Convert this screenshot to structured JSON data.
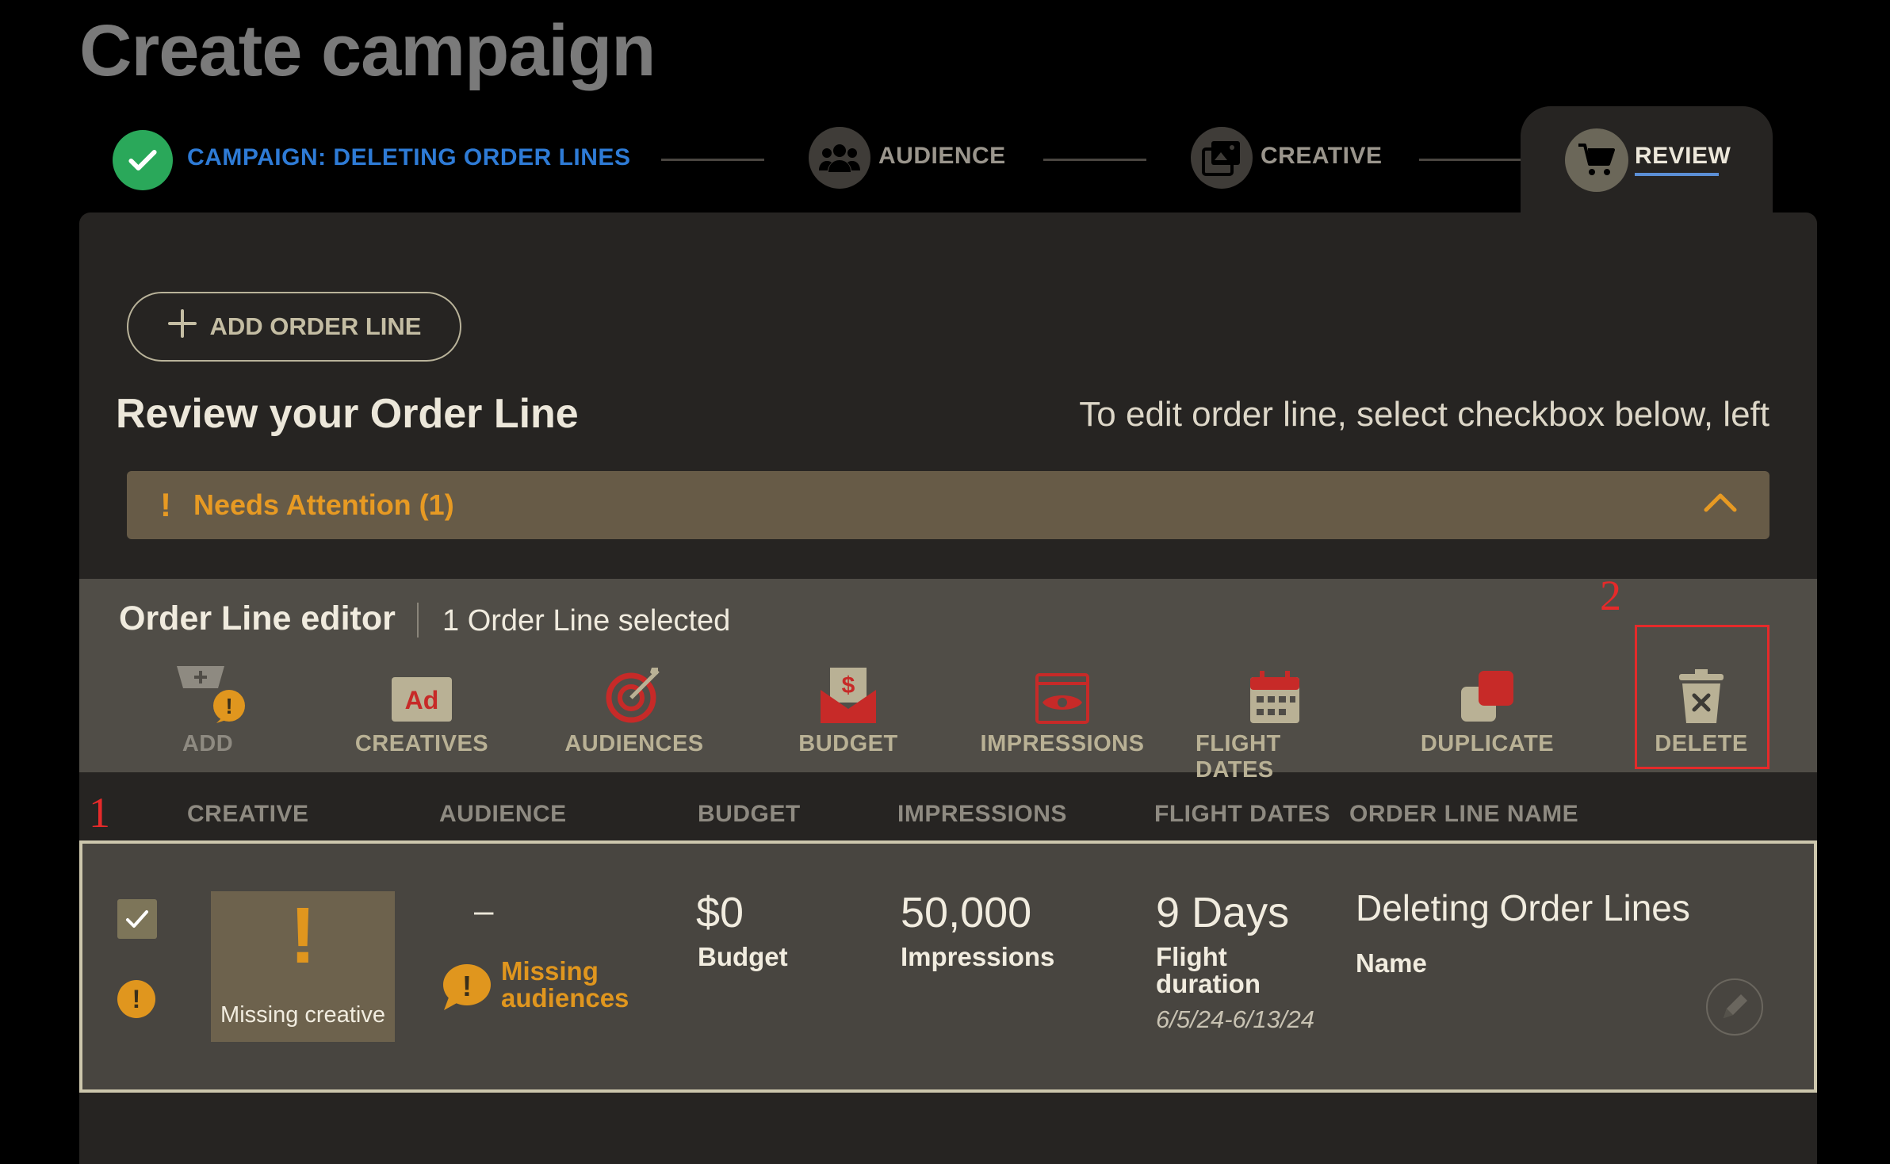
{
  "page": {
    "title": "Create campaign"
  },
  "stepper": {
    "campaign_label": "CAMPAIGN: DELETING ORDER LINES",
    "audience_label": "AUDIENCE",
    "creative_label": "CREATIVE",
    "review_label": "REVIEW"
  },
  "review": {
    "add_button": "ADD ORDER LINE",
    "heading": "Review your Order Line",
    "hint": "To edit order line, select checkbox below, left",
    "attention": "Needs Attention (1)"
  },
  "editor": {
    "title": "Order Line editor",
    "selected": "1 Order Line selected",
    "tools": {
      "add": "ADD",
      "creatives": "CREATIVES",
      "audiences": "AUDIENCES",
      "budget": "BUDGET",
      "impressions": "IMPRESSIONS",
      "flight_dates": "FLIGHT DATES",
      "duplicate": "DUPLICATE",
      "delete": "DELETE"
    },
    "creatives_icon_text": "Ad"
  },
  "annotations": {
    "one": "1",
    "two": "2"
  },
  "table": {
    "headers": {
      "creative": "CREATIVE",
      "audience": "AUDIENCE",
      "budget": "BUDGET",
      "impressions": "IMPRESSIONS",
      "flight_dates": "FLIGHT DATES",
      "order_line_name": "ORDER LINE NAME"
    },
    "row": {
      "creative_caption": "Missing creative",
      "audience_dash": "–",
      "audience_missing_1": "Missing",
      "audience_missing_2": "audiences",
      "budget_value": "$0",
      "budget_label": "Budget",
      "impressions_value": "50,000",
      "impressions_label": "Impressions",
      "flight_value": "9 Days",
      "flight_label_1": "Flight",
      "flight_label_2": "duration",
      "flight_range": "6/5/24-6/13/24",
      "name_value": "Deleting Order Lines",
      "name_label": "Name"
    }
  },
  "colors": {
    "accent_gold": "#e0961e",
    "success_green": "#2aa85a",
    "step_blue": "#2e7bd6",
    "annotation_red": "#e52a2a"
  }
}
